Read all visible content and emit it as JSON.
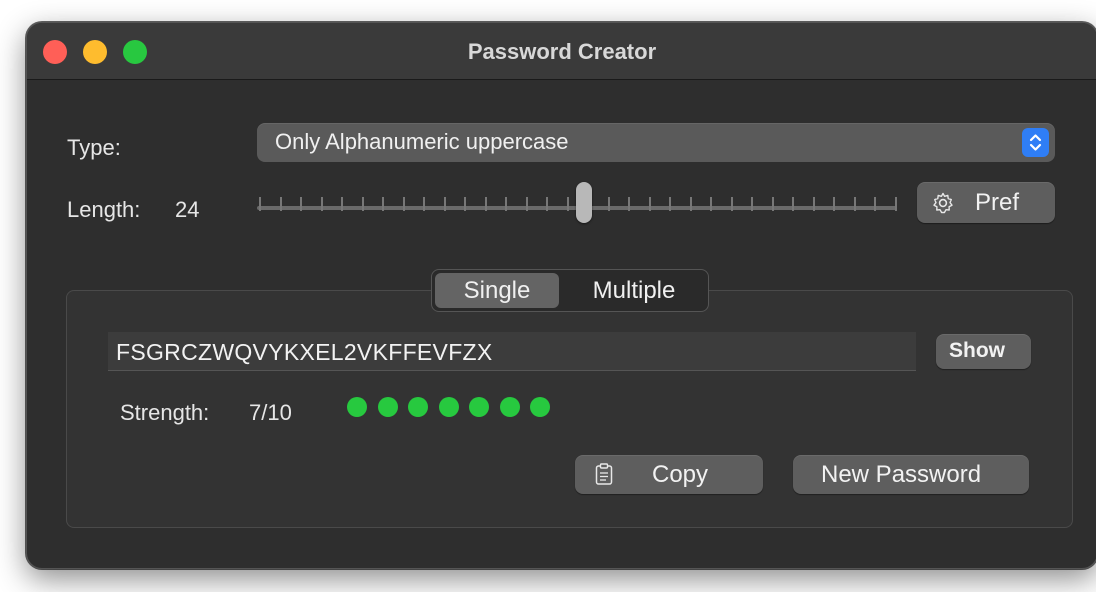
{
  "window": {
    "title": "Password Creator"
  },
  "type_row": {
    "label": "Type:",
    "selected": "Only Alphanumeric uppercase",
    "arrows_icon": "⌃⌄"
  },
  "length_row": {
    "label": "Length:",
    "value": "24",
    "pref_icon": "⚙",
    "pref_label": "Pref"
  },
  "mode": {
    "tabs": [
      "Single",
      "Multiple"
    ],
    "selected": "Single"
  },
  "password": {
    "value": "FSGRCZWQVYKXEL2VKFFEVFZX",
    "show_label": "Show"
  },
  "strength": {
    "label": "Strength:",
    "value": "7/10",
    "dots": 7,
    "dot_color": "#27c93f"
  },
  "actions": {
    "copy_icon": "📋",
    "copy_label": "Copy",
    "new_label": "New Password"
  },
  "colors": {
    "accent": "#2f7ef6",
    "close": "#ff5f57",
    "minimize": "#febc2e",
    "maximize": "#28c840"
  }
}
